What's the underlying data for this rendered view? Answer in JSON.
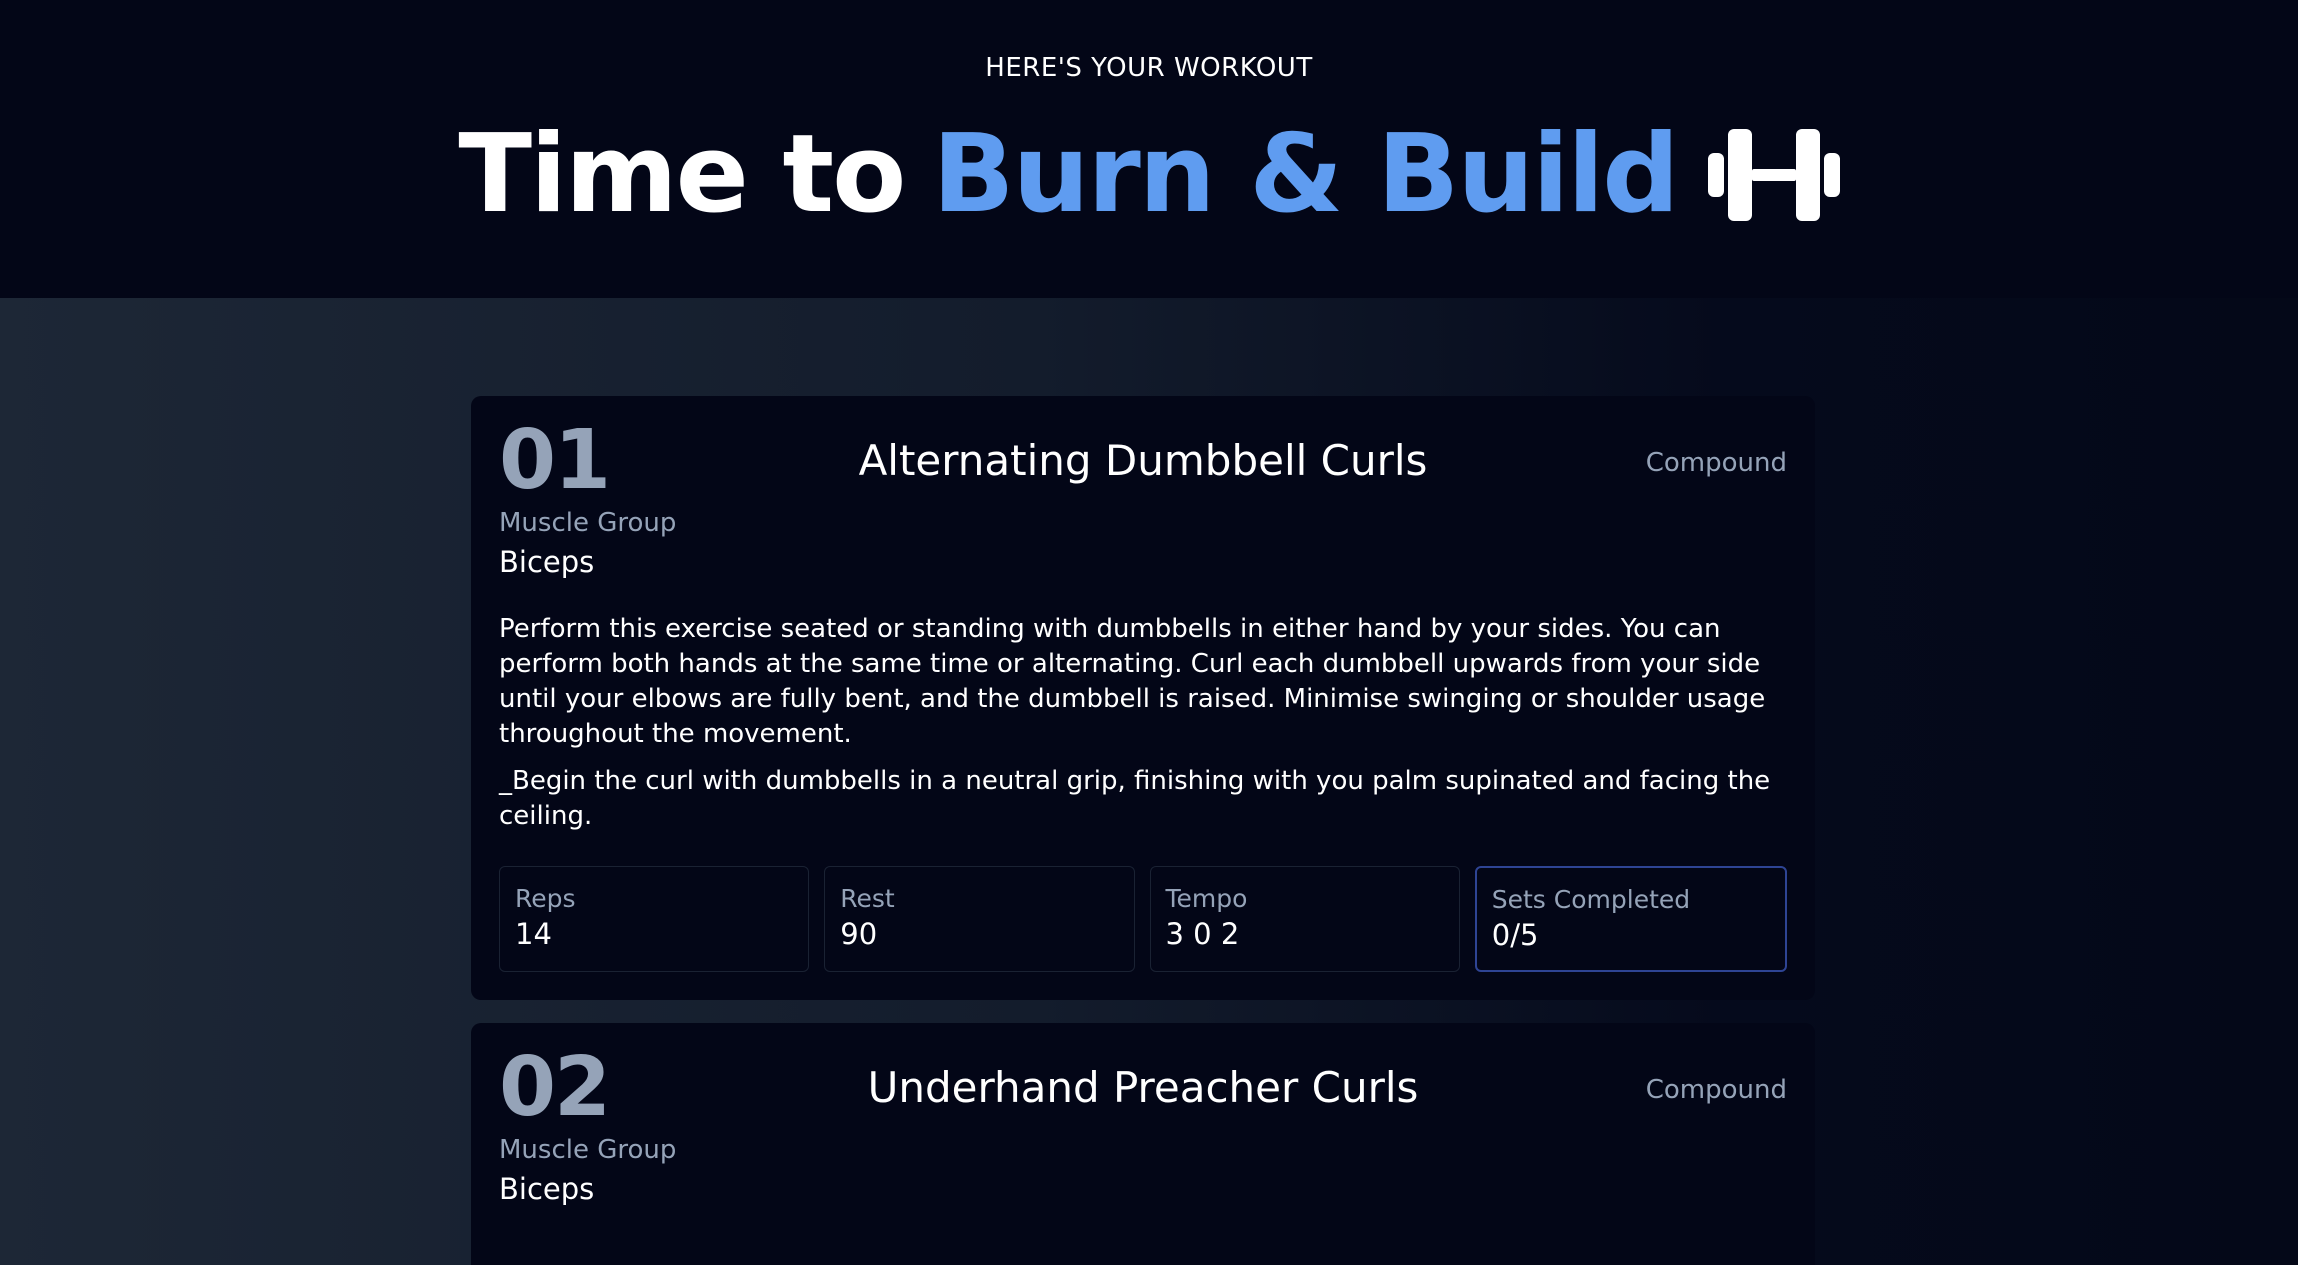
{
  "header": {
    "eyebrow": "HERE'S YOUR WORKOUT",
    "title_plain": "Time to",
    "title_accent": "Burn & Build",
    "title_icon": "dumbbell-icon",
    "accent_color": "#5f9cf0"
  },
  "exercises": [
    {
      "number": "01",
      "name": "Alternating Dumbbell Curls",
      "type": "Compound",
      "muscle_group_label": "Muscle Group",
      "muscle_group": "Biceps",
      "description": "Perform this exercise seated or standing with dumbbells in either hand by your sides. You can perform both hands at the same time or alternating. Curl each dumbbell upwards from your side until your elbows are fully bent, and the dumbbell is raised. Minimise swinging or shoulder usage throughout the movement.",
      "note": "_Begin the curl with dumbbells in a neutral grip, finishing with you palm supinated and facing the ceiling.",
      "stats": {
        "reps_label": "Reps",
        "reps": "14",
        "rest_label": "Rest",
        "rest": "90",
        "tempo_label": "Tempo",
        "tempo": "3 0 2",
        "sets_label": "Sets Completed",
        "sets": "0/5"
      }
    },
    {
      "number": "02",
      "name": "Underhand Preacher Curls",
      "type": "Compound",
      "muscle_group_label": "Muscle Group",
      "muscle_group": "Biceps"
    }
  ]
}
